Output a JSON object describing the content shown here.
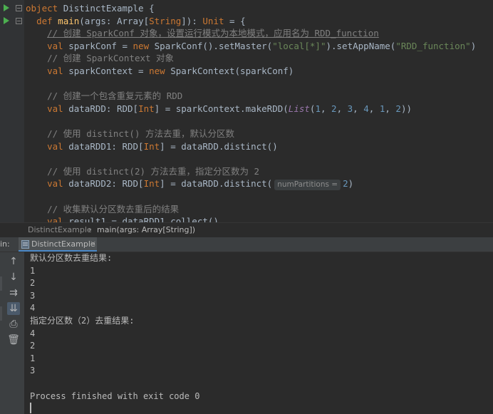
{
  "editor": {
    "lines": [
      {
        "indent": "",
        "parts": [
          {
            "c": "kw",
            "t": "object "
          },
          {
            "c": "ty",
            "t": "DistinctExample {"
          }
        ]
      },
      {
        "indent": "  ",
        "parts": [
          {
            "c": "kw",
            "t": "def "
          },
          {
            "c": "fn",
            "t": "main"
          },
          {
            "c": "ty",
            "t": "(args: Array["
          },
          {
            "c": "kw",
            "t": "String"
          },
          {
            "c": "ty",
            "t": "]): "
          },
          {
            "c": "kw",
            "t": "Unit"
          },
          {
            "c": "ty",
            "t": " = {"
          }
        ]
      },
      {
        "indent": "    ",
        "parts": [
          {
            "c": "cm ul",
            "t": "// 创建 SparkConf 对象，设置运行模式为本地模式，应用名为 RDD_function"
          }
        ]
      },
      {
        "indent": "    ",
        "parts": [
          {
            "c": "kw",
            "t": "val "
          },
          {
            "c": "ty",
            "t": "sparkConf = "
          },
          {
            "c": "kw",
            "t": "new "
          },
          {
            "c": "ty",
            "t": "SparkConf().setMaster("
          },
          {
            "c": "str",
            "t": "\"local[*]\""
          },
          {
            "c": "ty",
            "t": ").setAppName("
          },
          {
            "c": "str",
            "t": "\"RDD_function\""
          },
          {
            "c": "ty",
            "t": ")"
          }
        ]
      },
      {
        "indent": "    ",
        "parts": [
          {
            "c": "cm",
            "t": "// 创建 SparkContext 对象"
          }
        ]
      },
      {
        "indent": "    ",
        "parts": [
          {
            "c": "kw",
            "t": "val "
          },
          {
            "c": "ty",
            "t": "sparkContext = "
          },
          {
            "c": "kw",
            "t": "new "
          },
          {
            "c": "ty",
            "t": "SparkContext(sparkConf)"
          }
        ]
      },
      {
        "indent": "",
        "parts": []
      },
      {
        "indent": "    ",
        "parts": [
          {
            "c": "cm",
            "t": "// 创建一个包含重复元素的 RDD"
          }
        ]
      },
      {
        "indent": "    ",
        "parts": [
          {
            "c": "kw",
            "t": "val "
          },
          {
            "c": "ty",
            "t": "dataRDD: RDD["
          },
          {
            "c": "kw",
            "t": "Int"
          },
          {
            "c": "ty",
            "t": "] = sparkContext.makeRDD("
          },
          {
            "c": "list",
            "t": "List"
          },
          {
            "c": "ty",
            "t": "("
          },
          {
            "c": "num",
            "t": "1"
          },
          {
            "c": "ty",
            "t": ", "
          },
          {
            "c": "num",
            "t": "2"
          },
          {
            "c": "ty",
            "t": ", "
          },
          {
            "c": "num",
            "t": "3"
          },
          {
            "c": "ty",
            "t": ", "
          },
          {
            "c": "num",
            "t": "4"
          },
          {
            "c": "ty",
            "t": ", "
          },
          {
            "c": "num",
            "t": "1"
          },
          {
            "c": "ty",
            "t": ", "
          },
          {
            "c": "num",
            "t": "2"
          },
          {
            "c": "ty",
            "t": "))"
          }
        ]
      },
      {
        "indent": "",
        "parts": []
      },
      {
        "indent": "    ",
        "parts": [
          {
            "c": "cm",
            "t": "// 使用 distinct() 方法去重，默认分区数"
          }
        ]
      },
      {
        "indent": "    ",
        "parts": [
          {
            "c": "kw",
            "t": "val "
          },
          {
            "c": "ty",
            "t": "dataRDD1: RDD["
          },
          {
            "c": "kw",
            "t": "Int"
          },
          {
            "c": "ty",
            "t": "] = dataRDD.distinct()"
          }
        ]
      },
      {
        "indent": "",
        "parts": []
      },
      {
        "indent": "    ",
        "parts": [
          {
            "c": "cm",
            "t": "// 使用 distinct(2) 方法去重，指定分区数为 2"
          }
        ]
      },
      {
        "indent": "    ",
        "parts": [
          {
            "c": "kw",
            "t": "val "
          },
          {
            "c": "ty",
            "t": "dataRDD2: RDD["
          },
          {
            "c": "kw",
            "t": "Int"
          },
          {
            "c": "ty",
            "t": "] = dataRDD.distinct("
          },
          {
            "c": "hint",
            "t": "numPartitions ="
          },
          {
            "c": "num",
            "t": "2"
          },
          {
            "c": "ty",
            "t": ")"
          }
        ]
      },
      {
        "indent": "",
        "parts": []
      },
      {
        "indent": "    ",
        "parts": [
          {
            "c": "cm",
            "t": "// 收集默认分区数去重后的结果"
          }
        ]
      },
      {
        "indent": "    ",
        "parts": [
          {
            "c": "kw",
            "t": "val "
          },
          {
            "c": "ty",
            "t": "result1 = dataRDD1.collect()"
          }
        ]
      }
    ]
  },
  "breadcrumb": {
    "object": "DistinctExample",
    "separator": "›",
    "method": "main(args: Array[String])"
  },
  "run": {
    "label": "in:",
    "tab_label": "DistinctExample",
    "close": "×"
  },
  "toolbar": {
    "up": "↑",
    "down": "↓",
    "wrap": "⇉",
    "scroll": "⇊",
    "print": "⎙",
    "trash": "🗑"
  },
  "console": {
    "lines": [
      "默认分区数去重结果:",
      "1",
      "2",
      "3",
      "4",
      "指定分区数（2）去重结果:",
      "4",
      "2",
      "1",
      "3",
      "",
      "Process finished with exit code 0"
    ]
  }
}
